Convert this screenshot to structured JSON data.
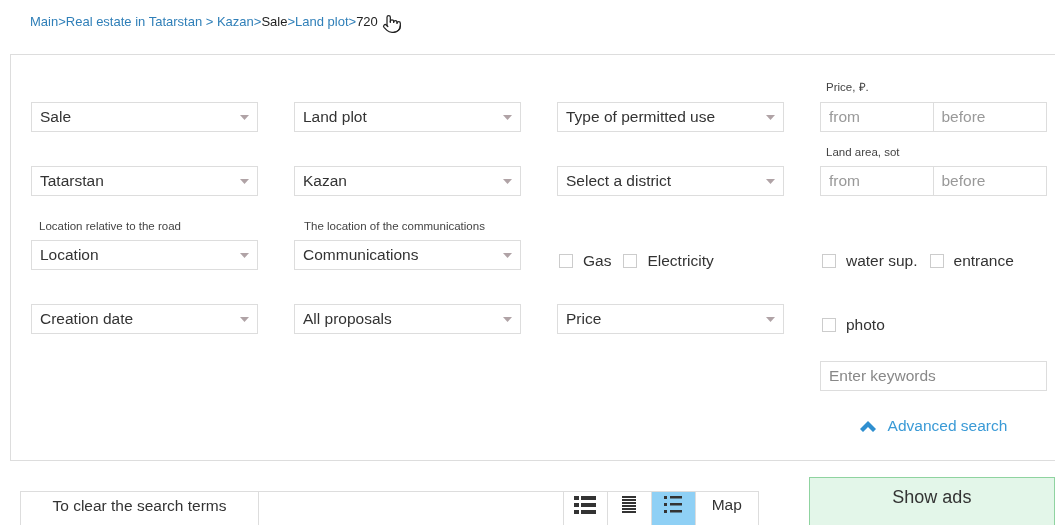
{
  "breadcrumb": [
    {
      "label": "Main>",
      "link": true
    },
    {
      "label": "Real estate in Tatarstan > ",
      "link": true
    },
    {
      "label": "Kazan>",
      "link": true
    },
    {
      "label": "Sale",
      "link": false
    },
    {
      "label": ">Land plot>",
      "link": true
    },
    {
      "label": "720",
      "link": false
    }
  ],
  "filters": [
    [
      {
        "kind": "select",
        "value": "Sale"
      },
      {
        "kind": "select",
        "value": "Land plot"
      },
      {
        "kind": "select",
        "value": "Type of permitted use"
      },
      {
        "kind": "range",
        "label": "Price, ₽.",
        "from_placeholder": "from",
        "to_placeholder": "before"
      }
    ],
    [
      {
        "kind": "select",
        "value": "Tatarstan"
      },
      {
        "kind": "select",
        "value": "Kazan"
      },
      {
        "kind": "select",
        "value": "Select a district"
      },
      {
        "kind": "range",
        "label": "Land area, sot",
        "from_placeholder": "from",
        "to_placeholder": "before"
      }
    ],
    [
      {
        "kind": "select",
        "label": "Location relative to the road",
        "value": "Location"
      },
      {
        "kind": "select",
        "label": "The location of the communications",
        "value": "Communications"
      },
      {
        "kind": "checks",
        "items": [
          {
            "label": "Gas",
            "checked": false
          },
          {
            "label": "Electricity",
            "checked": false
          }
        ]
      },
      {
        "kind": "checks",
        "items": [
          {
            "label": "water sup.",
            "checked": false
          },
          {
            "label": "entrance",
            "checked": false
          }
        ]
      }
    ],
    [
      {
        "kind": "select",
        "value": "Creation date"
      },
      {
        "kind": "select",
        "value": "All proposals"
      },
      {
        "kind": "select",
        "value": "Price"
      },
      {
        "kind": "checks",
        "items": [
          {
            "label": "photo",
            "checked": false
          }
        ]
      }
    ]
  ],
  "keywords": {
    "placeholder": "Enter keywords"
  },
  "advanced_search": {
    "label": "Advanced search"
  },
  "clear_button": "To clear the search terms",
  "views": [
    {
      "kind": "rows",
      "selected": false
    },
    {
      "kind": "lines",
      "selected": false
    },
    {
      "kind": "bullets",
      "selected": true
    },
    {
      "kind": "text",
      "label": "Map",
      "selected": false
    }
  ],
  "show_button": "Show ads"
}
